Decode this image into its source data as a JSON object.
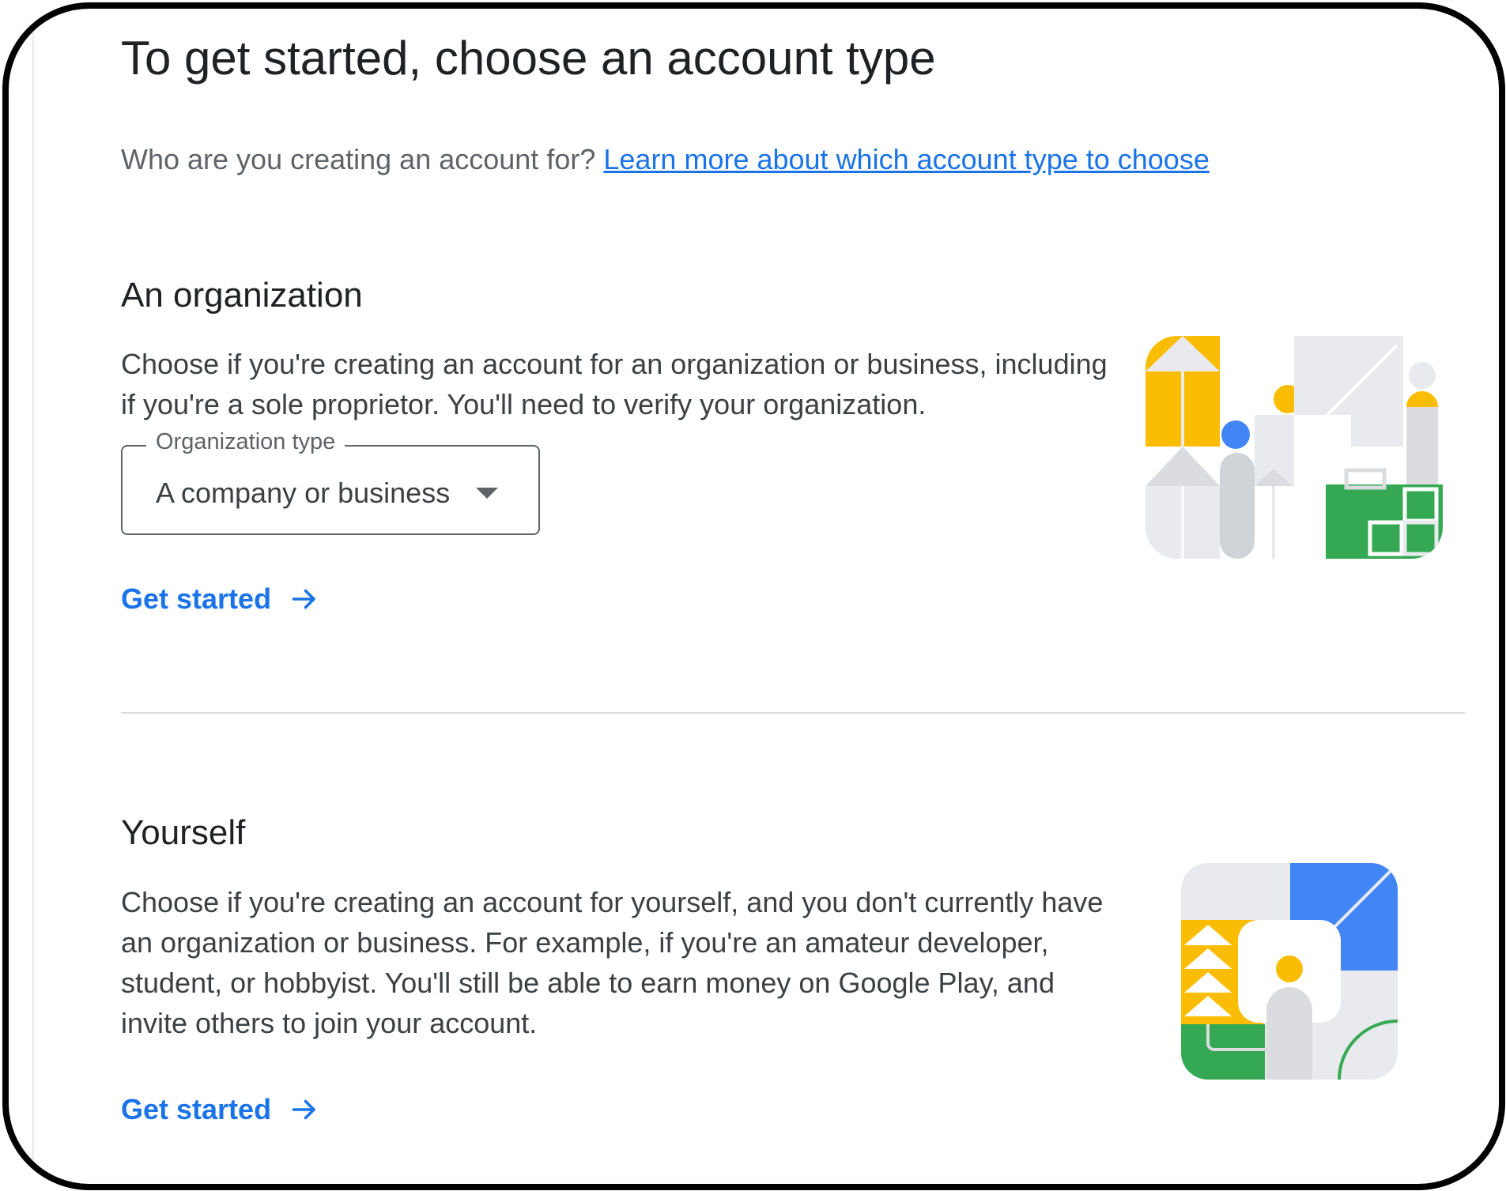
{
  "page": {
    "title": "To get started, choose an account type",
    "intro_question": "Who are you creating an account for?",
    "intro_link": "Learn more about which account type to choose"
  },
  "organization": {
    "title": "An organization",
    "description": "Choose if you're creating an account for an organization or business, including if you're a sole proprietor. You'll need to verify your organization.",
    "select_label": "Organization type",
    "select_value": "A company or business",
    "cta": "Get started",
    "illustration_icon": "organization-illustration"
  },
  "yourself": {
    "title": "Yourself",
    "description": "Choose if you're creating an account for yourself, and you don't currently have an organization or business. For example, if you're an amateur developer, student, or hobbyist. You'll still be able to earn money on Google Play, and invite others to join your account.",
    "cta": "Get started",
    "illustration_icon": "personal-illustration"
  },
  "colors": {
    "link_blue": "#1a73e8",
    "yellow": "#fbbc04",
    "blue": "#4285f4",
    "green": "#34a853",
    "gray": "#e8eaed",
    "gray_dark": "#dadce0",
    "text_primary": "#202124",
    "text_secondary": "#5f6368"
  }
}
